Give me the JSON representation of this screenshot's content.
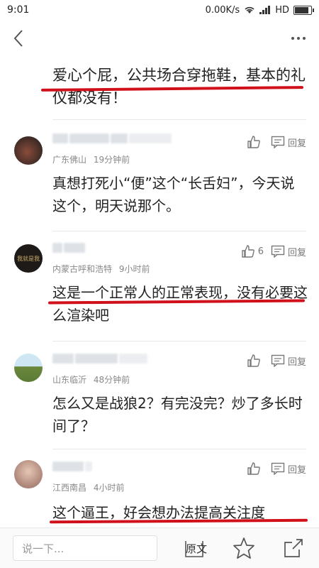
{
  "statusbar": {
    "time": "9:01",
    "speed": "0.00K/s",
    "network": "HD"
  },
  "article": {
    "quote": "爱心个屁，公共场合穿拖鞋，基本的礼仪都没有！"
  },
  "comments": [
    {
      "location": "广东佛山",
      "time": "19分钟前",
      "likes": "",
      "reply_label": "回复",
      "text": "真想打死小“便”这个“长舌妇”，今天说这个，明天说那个。"
    },
    {
      "location": "内蒙古呼和浩特",
      "time": "9小时前",
      "likes": "6",
      "reply_label": "回复",
      "avatar_text": "我就是我",
      "text": "这是一个正常人的正常表现，没有必要这么渲染吧"
    },
    {
      "location": "山东临沂",
      "time": "48分钟前",
      "likes": "",
      "reply_label": "回复",
      "text": "怎么又是战狼2？有完没完？炒了多长时间了？"
    },
    {
      "location": "江西南昌",
      "time": "4小时前",
      "likes": "",
      "reply_label": "回复",
      "text": "这个逼王，好会想办法提高关注度"
    }
  ],
  "bottombar": {
    "placeholder": "说一下...",
    "source_label": "原文"
  },
  "colors": {
    "highlight_line": "#d0101a",
    "meta": "#888888"
  }
}
